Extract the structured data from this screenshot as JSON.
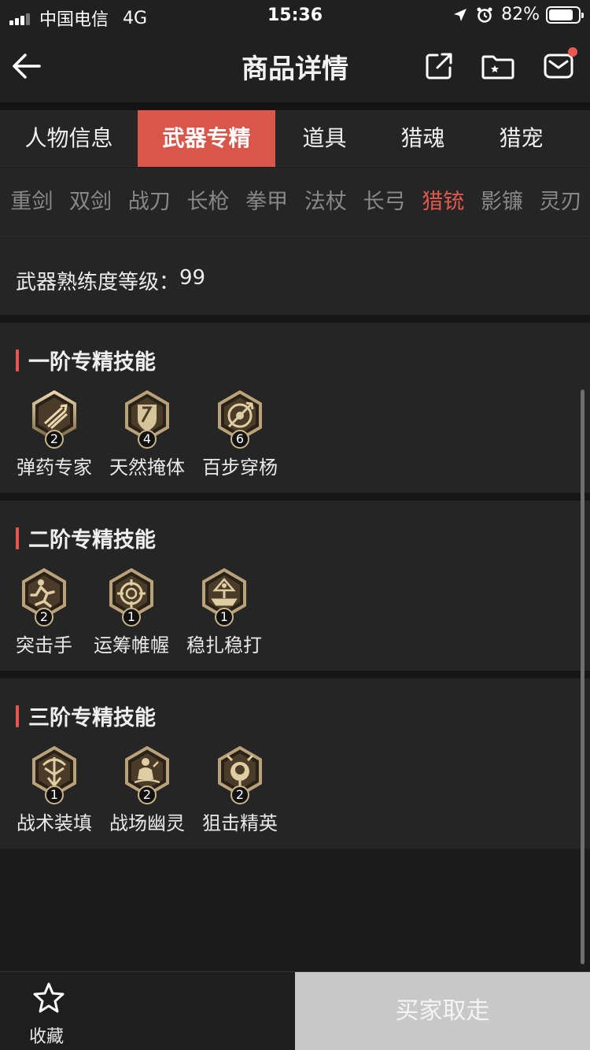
{
  "status_bar": {
    "carrier": "中国电信",
    "network": "4G",
    "time": "15:36",
    "battery": "82%",
    "battery_level": 0.82
  },
  "nav": {
    "title": "商品详情",
    "icons": [
      "back-arrow-icon",
      "share-icon",
      "folder-star-icon",
      "mail-icon"
    ],
    "mail_has_badge": true
  },
  "main_tabs": [
    {
      "label": "人物信息",
      "active": false
    },
    {
      "label": "武器专精",
      "active": true
    },
    {
      "label": "道具",
      "active": false
    },
    {
      "label": "猎魂",
      "active": false
    },
    {
      "label": "猎宠",
      "active": false
    }
  ],
  "weapon_tabs": [
    {
      "label": "重剑",
      "active": false
    },
    {
      "label": "双剑",
      "active": false
    },
    {
      "label": "战刀",
      "active": false
    },
    {
      "label": "长枪",
      "active": false
    },
    {
      "label": "拳甲",
      "active": false
    },
    {
      "label": "法杖",
      "active": false
    },
    {
      "label": "长弓",
      "active": false
    },
    {
      "label": "猎铳",
      "active": true
    },
    {
      "label": "影镰",
      "active": false
    },
    {
      "label": "灵刃",
      "active": false
    }
  ],
  "weapon_level": {
    "label": "武器熟练度等级：",
    "value": "99"
  },
  "sections": [
    {
      "title": "一阶专精技能",
      "skills": [
        {
          "name": "弹药专家",
          "count": "2",
          "icon": "ammo-icon"
        },
        {
          "name": "天然掩体",
          "count": "4",
          "icon": "shield-icon"
        },
        {
          "name": "百步穿杨",
          "count": "6",
          "icon": "target-icon"
        }
      ]
    },
    {
      "title": "二阶专精技能",
      "skills": [
        {
          "name": "突击手",
          "count": "2",
          "icon": "runner-icon"
        },
        {
          "name": "运筹帷幄",
          "count": "1",
          "icon": "crosshair-icon"
        },
        {
          "name": "稳扎稳打",
          "count": "1",
          "icon": "tripod-icon"
        }
      ]
    },
    {
      "title": "三阶专精技能",
      "skills": [
        {
          "name": "战术装填",
          "count": "1",
          "icon": "bow-icon"
        },
        {
          "name": "战场幽灵",
          "count": "2",
          "icon": "ghost-icon"
        },
        {
          "name": "狙击精英",
          "count": "2",
          "icon": "sniper-icon"
        }
      ]
    }
  ],
  "bottom": {
    "collect_label": "收藏",
    "buy_label": "买家取走"
  },
  "colors": {
    "accent": "#d9564b",
    "active_text": "#e2584c",
    "skill_gold": "#c9b48a"
  }
}
